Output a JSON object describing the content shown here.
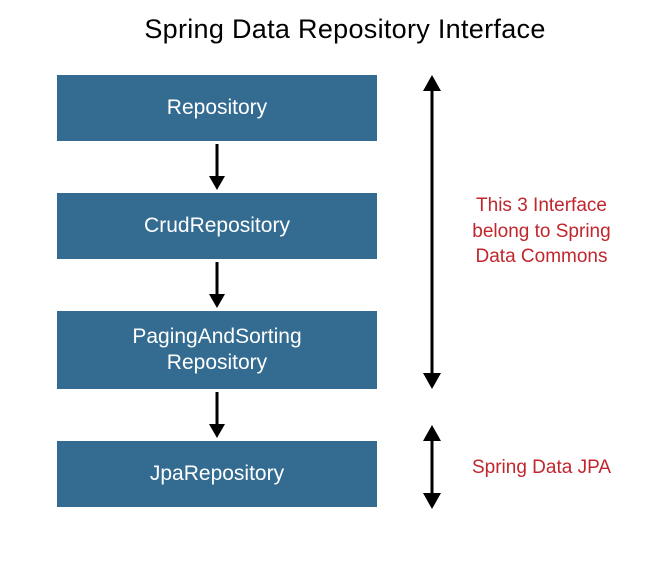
{
  "title": "Spring Data Repository Interface",
  "boxes": {
    "b1": "Repository",
    "b2": "CrudRepository",
    "b3": "PagingAndSorting\nRepository",
    "b4": "JpaRepository"
  },
  "annotations": {
    "commons": "This 3 Interface belong to Spring Data Commons",
    "jpa": "Spring Data JPA"
  },
  "colors": {
    "box_bg": "#336b91",
    "annotation": "#c0262d"
  }
}
